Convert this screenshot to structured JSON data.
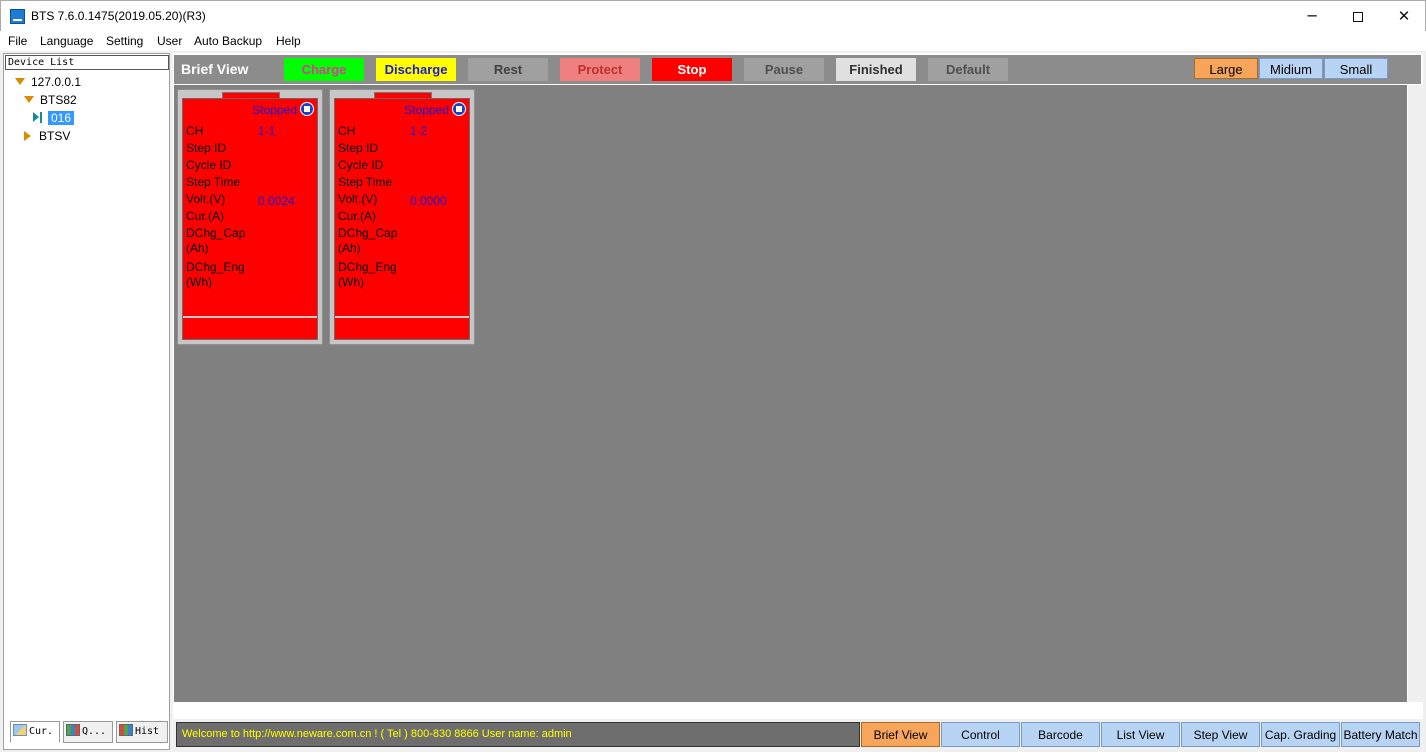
{
  "window": {
    "title": "BTS 7.6.0.1475(2019.05.20)(R3)",
    "minimize": "─",
    "close": "✕"
  },
  "menu": [
    "File",
    "Language",
    "Setting",
    "User",
    "Auto Backup",
    "Help"
  ],
  "device_list": {
    "header": "Device List",
    "nodes": {
      "ip": "127.0.0.1",
      "bts82": "BTS82",
      "unit": "016",
      "btsv": "BTSV"
    }
  },
  "left_tabs": [
    "Cur.",
    "Q...",
    "Hist"
  ],
  "status_bar": {
    "title": "Brief View",
    "legend": [
      {
        "label": "Charge",
        "bg": "#00ff00",
        "fg": "#e0399c"
      },
      {
        "label": "Discharge",
        "bg": "#ffff00",
        "fg": "#1a1ad8"
      },
      {
        "label": "Rest",
        "bg": "#a0a0a0",
        "fg": "#404040"
      },
      {
        "label": "Protect",
        "bg": "#f08080",
        "fg": "#c03030"
      },
      {
        "label": "Stop",
        "bg": "#ff0000",
        "fg": "#ffffff"
      },
      {
        "label": "Pause",
        "bg": "#a0a0a0",
        "fg": "#505050"
      },
      {
        "label": "Finished",
        "bg": "#e0e0e0",
        "fg": "#303030"
      },
      {
        "label": "Default",
        "bg": "#a0a0a0",
        "fg": "#505050"
      }
    ],
    "sizes": [
      {
        "label": "Large",
        "active": true
      },
      {
        "label": "Midium",
        "active": false
      },
      {
        "label": "Small",
        "active": false
      }
    ]
  },
  "card_labels": {
    "ch": "CH",
    "step_id": "Step ID",
    "cycle_id": "Cycle ID",
    "step_time": "Step Time",
    "volt": "Volt.(V)",
    "cur": "Cur.(A)",
    "dchg_cap": "DChg_Cap",
    "dchg_cap_unit": "(Ah)",
    "dchg_eng": "DChg_Eng",
    "dchg_eng_unit": "(Wh)"
  },
  "channels": [
    {
      "status": "Stopped",
      "ch": "1-1",
      "volt": "0.0024"
    },
    {
      "status": "Stopped",
      "ch": "1-2",
      "volt": "0.0000"
    }
  ],
  "bottom": {
    "welcome": "Welcome to http://www.neware.com.cn !    ( Tel ) 800-830 8866  User name: admin",
    "nav": [
      {
        "label": "Brief View",
        "active": true
      },
      {
        "label": "Control",
        "active": false
      },
      {
        "label": "Barcode",
        "active": false
      },
      {
        "label": "List View",
        "active": false
      },
      {
        "label": "Step View",
        "active": false
      },
      {
        "label": "Cap. Grading",
        "active": false
      },
      {
        "label": "Battery Match",
        "active": false
      }
    ]
  }
}
